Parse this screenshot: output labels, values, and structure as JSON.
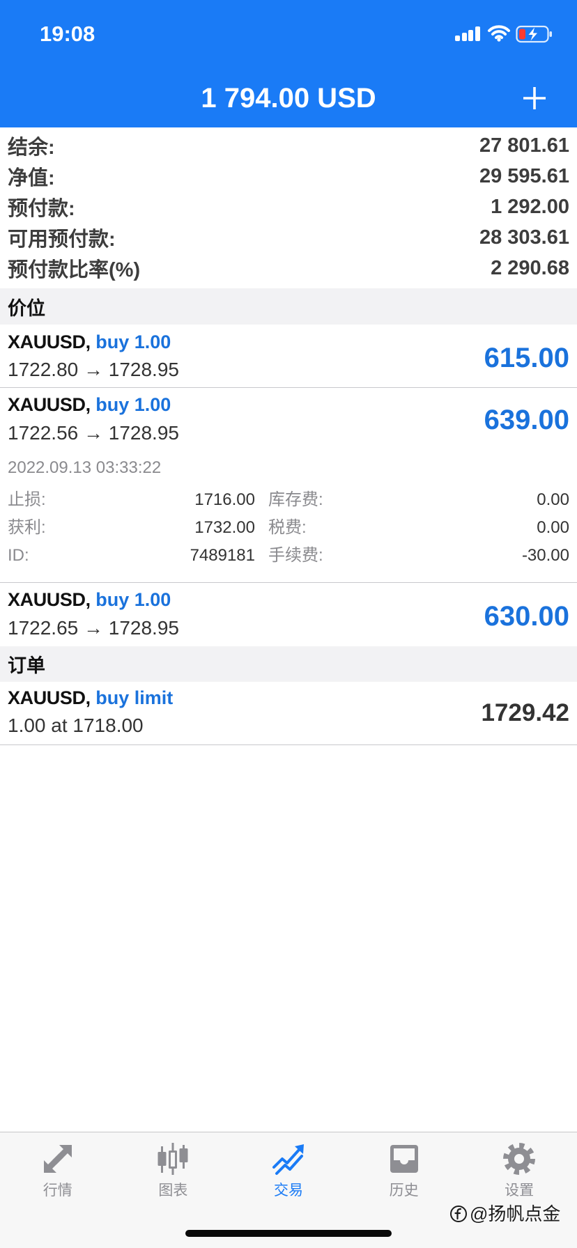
{
  "status_bar": {
    "time": "19:08",
    "icons": [
      "signal-icon",
      "wifi-icon",
      "battery-charging-icon"
    ]
  },
  "header": {
    "title": "1 794.00 USD",
    "action_icon": "plus-icon"
  },
  "summary": [
    {
      "label": "结余:",
      "value": "27 801.61"
    },
    {
      "label": "净值:",
      "value": "29 595.61"
    },
    {
      "label": "预付款:",
      "value": "1 292.00"
    },
    {
      "label": "可用预付款:",
      "value": "28 303.61"
    },
    {
      "label": "预付款比率(%)",
      "value": "2 290.68"
    }
  ],
  "positions_section": {
    "title": "价位"
  },
  "positions": [
    {
      "symbol": "XAUUSD,",
      "type": "buy 1.00",
      "prices": "1722.80 → 1728.95",
      "profit": "615.00"
    },
    {
      "symbol": "XAUUSD,",
      "type": "buy 1.00",
      "prices": "1722.56 → 1728.95",
      "profit": "639.00",
      "details": {
        "time": "2022.09.13 03:33:22",
        "rows": [
          {
            "label": "止损:",
            "value": "1716.00",
            "label2": "库存费:",
            "value2": "0.00"
          },
          {
            "label": "获利:",
            "value": "1732.00",
            "label2": "税费:",
            "value2": "0.00"
          },
          {
            "label": "ID:",
            "value": "7489181",
            "label2": "手续费:",
            "value2": "-30.00"
          }
        ]
      }
    },
    {
      "symbol": "XAUUSD,",
      "type": "buy 1.00",
      "prices": "1722.65 → 1728.95",
      "profit": "630.00"
    }
  ],
  "orders_section": {
    "title": "订单"
  },
  "orders": [
    {
      "symbol": "XAUUSD,",
      "type": "buy limit",
      "info": "1.00 at 1718.00",
      "price": "1729.42"
    }
  ],
  "tabs": [
    {
      "label": "行情",
      "icon": "quotes-icon",
      "active": false
    },
    {
      "label": "图表",
      "icon": "chart-icon",
      "active": false
    },
    {
      "label": "交易",
      "icon": "trade-icon",
      "active": true
    },
    {
      "label": "历史",
      "icon": "history-icon",
      "active": false
    },
    {
      "label": "设置",
      "icon": "settings-icon",
      "active": false
    }
  ],
  "watermark": {
    "text": "@扬帆点金",
    "icon": "watermark-logo-icon"
  },
  "colors": {
    "accent": "#1a7bf6",
    "profit": "#1a72dc",
    "section_bg": "#f2f2f4",
    "tab_inactive": "#8e8e93",
    "battery_low": "#ff3b30"
  }
}
